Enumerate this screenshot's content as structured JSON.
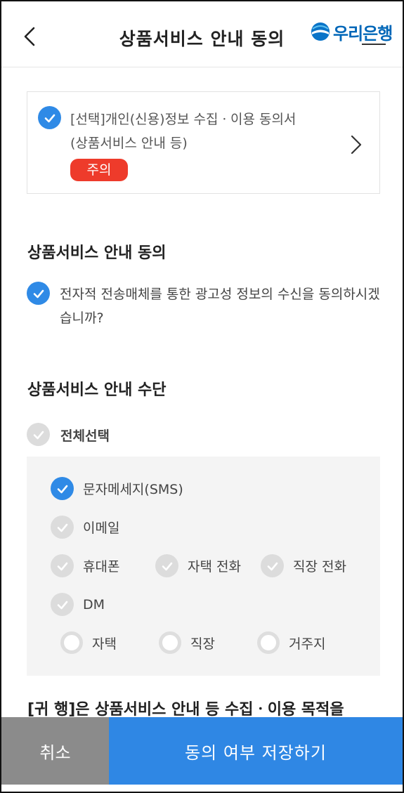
{
  "header": {
    "title": "상품서비스 안내 동의",
    "logo_text": "우리은행"
  },
  "consent_card": {
    "line1": "[선택]개인(신용)정보 수집ㆍ이용 동의서",
    "line2": "(상품서비스 안내 등)",
    "badge": "주의",
    "checked": true
  },
  "agreement": {
    "title": "상품서비스 안내 동의",
    "question": "전자적 전송매체를 통한 광고성 정보의 수신을 동의하시겠습니까?",
    "checked": true
  },
  "channels": {
    "title": "상품서비스 안내 수단",
    "select_all": "전체선택",
    "options": [
      {
        "label": "문자메세지(SMS)",
        "checked": true
      },
      {
        "label": "이메일",
        "checked": false
      },
      {
        "label": "휴대폰",
        "checked": false
      },
      {
        "label": "자택 전화",
        "checked": false
      },
      {
        "label": "직장 전화",
        "checked": false
      },
      {
        "label": "DM",
        "checked": false
      }
    ],
    "dm_targets": [
      "자택",
      "직장",
      "거주지"
    ]
  },
  "cutoff_text": "[귀 행]은 상품서비스 안내 등 수집ㆍ이용 목적을",
  "footer": {
    "cancel": "취소",
    "save": "동의 여부 저장하기"
  },
  "colors": {
    "accent": "#2f87e4",
    "badge": "#ee3b2b",
    "cancel": "#8b8b8b",
    "brand": "#0067b8"
  }
}
